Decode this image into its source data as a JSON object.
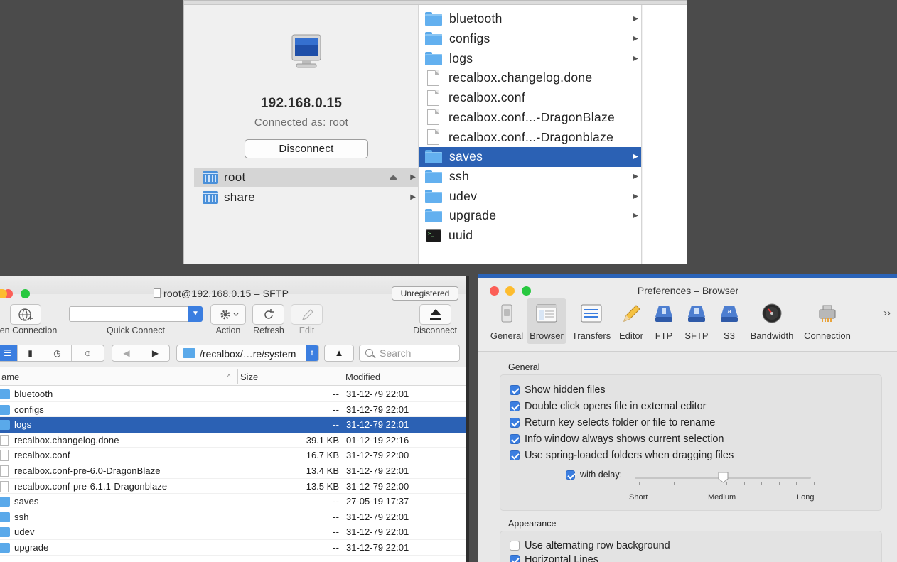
{
  "finder": {
    "ip": "192.168.0.15",
    "connected_as": "Connected as: root",
    "disconnect_label": "Disconnect",
    "shares": [
      {
        "label": "root",
        "selected": true
      },
      {
        "label": "share",
        "selected": false
      }
    ],
    "items": [
      {
        "label": "bluetooth",
        "kind": "folder",
        "arrow": true
      },
      {
        "label": "configs",
        "kind": "folder",
        "arrow": true
      },
      {
        "label": "logs",
        "kind": "folder",
        "arrow": true
      },
      {
        "label": "recalbox.changelog.done",
        "kind": "doc",
        "arrow": false
      },
      {
        "label": "recalbox.conf",
        "kind": "doc",
        "arrow": false
      },
      {
        "label": "recalbox.conf...-DragonBlaze",
        "kind": "doc",
        "arrow": false
      },
      {
        "label": "recalbox.conf...-Dragonblaze",
        "kind": "doc",
        "arrow": false
      },
      {
        "label": "saves",
        "kind": "folder",
        "arrow": true,
        "selected": true
      },
      {
        "label": "ssh",
        "kind": "folder",
        "arrow": true
      },
      {
        "label": "udev",
        "kind": "folder",
        "arrow": true
      },
      {
        "label": "upgrade",
        "kind": "folder",
        "arrow": true
      },
      {
        "label": "uuid",
        "kind": "exec",
        "arrow": false
      }
    ]
  },
  "transmit": {
    "title": "root@192.168.0.15 – SFTP",
    "unregistered": "Unregistered",
    "toolbar": {
      "open_connection": "en Connection",
      "quick_connect": "Quick Connect",
      "action": "Action",
      "refresh": "Refresh",
      "edit": "Edit",
      "disconnect": "Disconnect"
    },
    "path": "/recalbox/…re/system",
    "search_placeholder": "Search",
    "columns": {
      "name": "ame",
      "size": "Size",
      "modified": "Modified"
    },
    "rows": [
      {
        "name": "bluetooth",
        "size": "--",
        "modified": "31-12-79 22:01",
        "kind": "folder"
      },
      {
        "name": "configs",
        "size": "--",
        "modified": "31-12-79 22:01",
        "kind": "folder"
      },
      {
        "name": "logs",
        "size": "--",
        "modified": "31-12-79 22:01",
        "kind": "folder",
        "selected": true
      },
      {
        "name": "recalbox.changelog.done",
        "size": "39.1 KB",
        "modified": "01-12-19 22:16",
        "kind": "doc"
      },
      {
        "name": "recalbox.conf",
        "size": "16.7 KB",
        "modified": "31-12-79 22:00",
        "kind": "doc"
      },
      {
        "name": "recalbox.conf-pre-6.0-DragonBlaze",
        "size": "13.4 KB",
        "modified": "31-12-79 22:01",
        "kind": "doc"
      },
      {
        "name": "recalbox.conf-pre-6.1.1-Dragonblaze",
        "size": "13.5 KB",
        "modified": "31-12-79 22:00",
        "kind": "doc"
      },
      {
        "name": "saves",
        "size": "--",
        "modified": "27-05-19 17:37",
        "kind": "folder"
      },
      {
        "name": "ssh",
        "size": "--",
        "modified": "31-12-79 22:01",
        "kind": "folder"
      },
      {
        "name": "udev",
        "size": "--",
        "modified": "31-12-79 22:01",
        "kind": "folder"
      },
      {
        "name": "upgrade",
        "size": "--",
        "modified": "31-12-79 22:01",
        "kind": "folder"
      }
    ]
  },
  "prefs": {
    "title": "Preferences – Browser",
    "tabs": [
      "General",
      "Browser",
      "Transfers",
      "Editor",
      "FTP",
      "SFTP",
      "S3",
      "Bandwidth",
      "Connection"
    ],
    "selected_tab": "Browser",
    "more": "››",
    "general_label": "General",
    "options": [
      {
        "label": "Show hidden files",
        "checked": true
      },
      {
        "label": "Double click opens file in external editor",
        "checked": true
      },
      {
        "label": "Return key selects folder or file to rename",
        "checked": true
      },
      {
        "label": "Info window always shows current selection",
        "checked": true
      },
      {
        "label": "Use spring-loaded folders when dragging files",
        "checked": true
      }
    ],
    "delay_label": "with delay:",
    "delay_checked": true,
    "slider_labels": [
      "Short",
      "Medium",
      "Long"
    ],
    "slider_value": 0.5,
    "appearance_label": "Appearance",
    "appearance_options": [
      {
        "label": "Use alternating row background",
        "checked": false
      },
      {
        "label": "Horizontal Lines",
        "checked": true
      }
    ]
  },
  "colors": {
    "selection": "#2b61b4",
    "accent": "#3b7ee0",
    "folder": "#63b0ef",
    "close": "#fc5f57",
    "minimize": "#fdbc2e",
    "zoom": "#28c840"
  }
}
